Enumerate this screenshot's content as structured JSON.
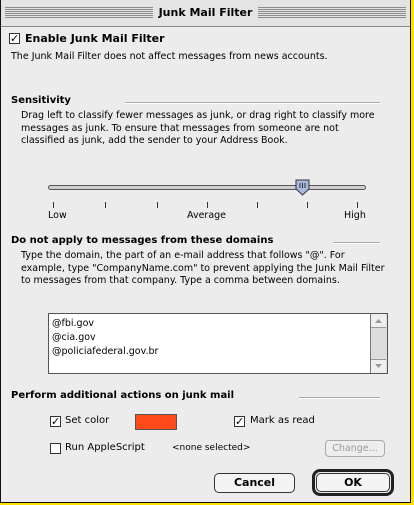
{
  "window": {
    "title": "Junk Mail Filter"
  },
  "enable": {
    "checked": true,
    "label": "Enable Junk Mail Filter",
    "note": "The Junk Mail Filter does not affect messages from news accounts."
  },
  "sensitivity": {
    "heading": "Sensitivity",
    "description": "Drag left to classify fewer messages as junk, or drag right to classify more messages as junk. To ensure that messages from someone are not classified as junk, add the sender to your Address Book.",
    "label_low": "Low",
    "label_average": "Average",
    "label_high": "High",
    "value_fraction": 0.8
  },
  "domains": {
    "heading": "Do not apply to messages from these domains",
    "description": "Type the domain, the part of an e-mail address that follows \"@\". For example, type \"CompanyName.com\" to prevent applying the Junk Mail Filter to messages from that company. Type a comma between domains.",
    "entries": [
      "@fbi.gov",
      "@cia.gov",
      "@policiafederal.gov.br"
    ]
  },
  "actions": {
    "heading": "Perform additional actions on junk mail",
    "set_color": {
      "checked": true,
      "label": "Set color",
      "color": "#ff4a1a"
    },
    "mark_read": {
      "checked": true,
      "label": "Mark as read"
    },
    "applescript": {
      "checked": false,
      "label": "Run AppleScript",
      "selection": "<none selected>"
    },
    "change_label": "Change..."
  },
  "buttons": {
    "cancel": "Cancel",
    "ok": "OK"
  }
}
